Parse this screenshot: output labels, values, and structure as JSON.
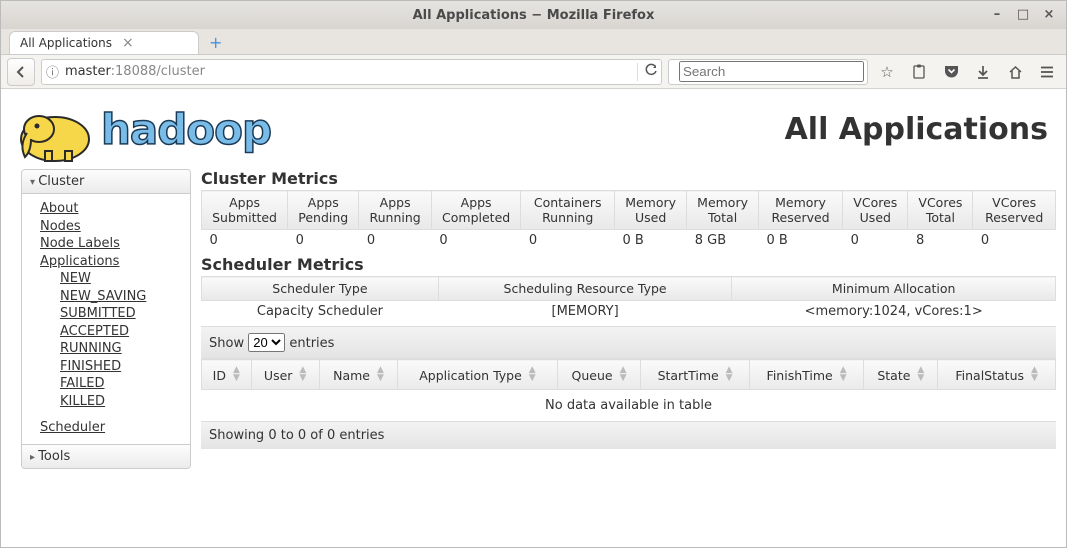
{
  "window": {
    "title": "All Applications − Mozilla Firefox"
  },
  "tab": {
    "title": "All Applications"
  },
  "url": {
    "host": "master",
    "pathport": ":18088/cluster"
  },
  "search": {
    "placeholder": "Search"
  },
  "page_heading": "All Applications",
  "sidebar": {
    "cluster_header": "Cluster",
    "tools_header": "Tools",
    "cluster_links": {
      "about": "About",
      "nodes": "Nodes",
      "node_labels": "Node Labels",
      "applications": "Applications",
      "scheduler": "Scheduler"
    },
    "app_states": [
      "NEW",
      "NEW_SAVING",
      "SUBMITTED",
      "ACCEPTED",
      "RUNNING",
      "FINISHED",
      "FAILED",
      "KILLED"
    ]
  },
  "cluster_metrics": {
    "title": "Cluster Metrics",
    "headers": [
      "Apps Submitted",
      "Apps Pending",
      "Apps Running",
      "Apps Completed",
      "Containers Running",
      "Memory Used",
      "Memory Total",
      "Memory Reserved",
      "VCores Used",
      "VCores Total",
      "VCores Reserved"
    ],
    "values": [
      "0",
      "0",
      "0",
      "0",
      "0",
      "0 B",
      "8 GB",
      "0 B",
      "0",
      "8",
      "0"
    ]
  },
  "scheduler_metrics": {
    "title": "Scheduler Metrics",
    "headers": [
      "Scheduler Type",
      "Scheduling Resource Type",
      "Minimum Allocation"
    ],
    "values": [
      "Capacity Scheduler",
      "[MEMORY]",
      "<memory:1024, vCores:1>"
    ]
  },
  "apps_table": {
    "show_label_pre": "Show",
    "show_value": "20",
    "show_label_post": "entries",
    "headers": [
      "ID",
      "User",
      "Name",
      "Application Type",
      "Queue",
      "StartTime",
      "FinishTime",
      "State",
      "FinalStatus"
    ],
    "no_data": "No data available in table",
    "footer": "Showing 0 to 0 of 0 entries"
  }
}
